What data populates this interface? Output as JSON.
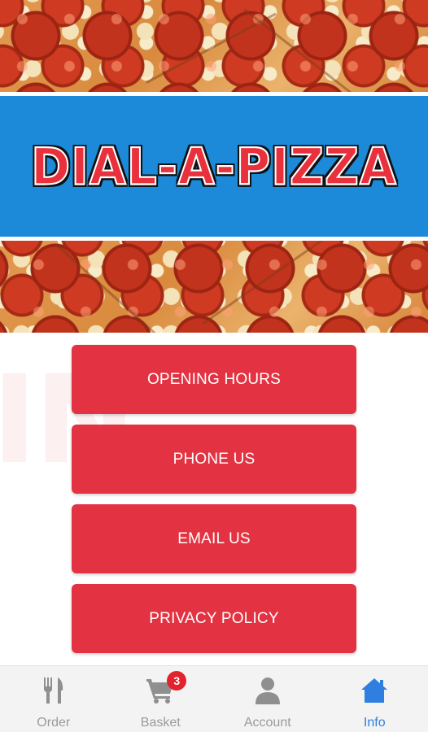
{
  "banner": {
    "title": "DIAL-A-PIZZA"
  },
  "menu": {
    "buttons": [
      {
        "label": "OPENING HOURS"
      },
      {
        "label": "PHONE US"
      },
      {
        "label": "EMAIL US"
      },
      {
        "label": "PRIVACY POLICY"
      }
    ]
  },
  "tabbar": {
    "tabs": [
      {
        "label": "Order",
        "icon": "fork-knife-icon",
        "active": false
      },
      {
        "label": "Basket",
        "icon": "cart-icon",
        "active": false,
        "badge": "3"
      },
      {
        "label": "Account",
        "icon": "person-icon",
        "active": false
      },
      {
        "label": "Info",
        "icon": "home-icon",
        "active": true
      }
    ]
  },
  "colors": {
    "banner_blue": "#1c8ad9",
    "button_red": "#e33342",
    "active_tab_blue": "#2e7fe0",
    "inactive_tab_gray": "#9a9a9a",
    "badge_red": "#e2232e"
  }
}
